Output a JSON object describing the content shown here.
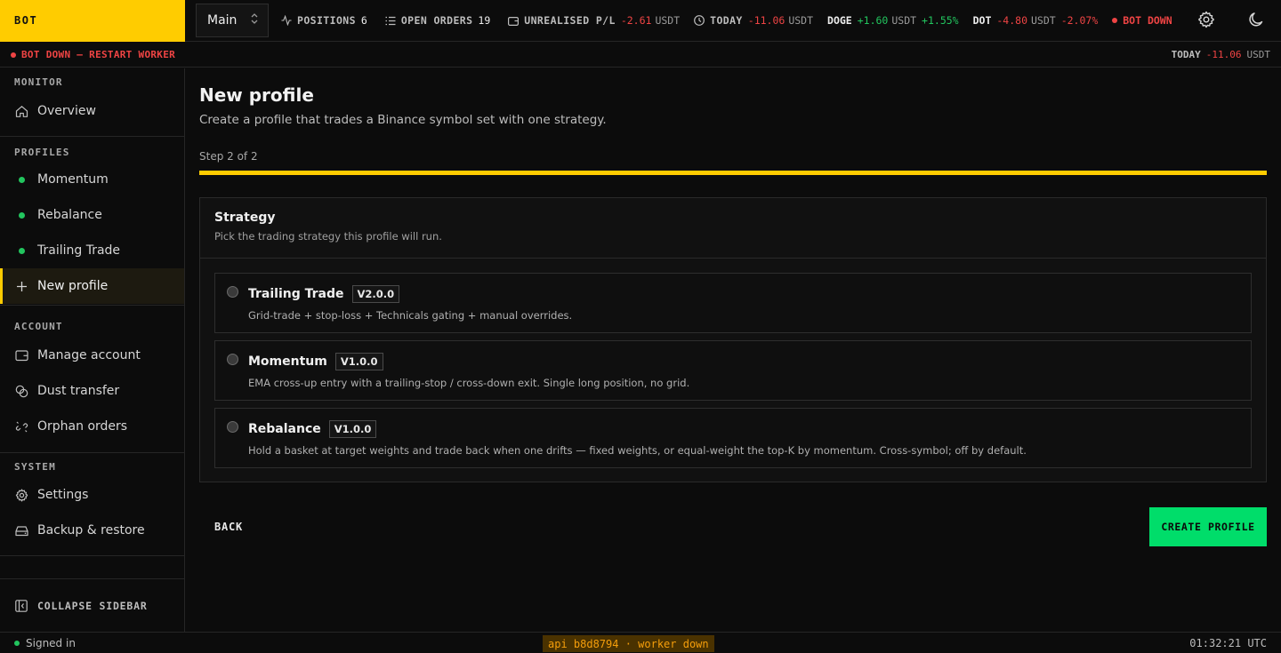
{
  "brand": "BOT",
  "account_selector": {
    "label": "Main"
  },
  "stats": {
    "positions": {
      "label": "POSITIONS",
      "value": "6"
    },
    "open_orders": {
      "label": "OPEN ORDERS",
      "value": "19"
    },
    "unrealised": {
      "label": "UNREALISED P/L",
      "value": "-2.61",
      "unit": "USDT"
    },
    "today": {
      "label": "TODAY",
      "value": "-11.06",
      "unit": "USDT"
    },
    "doge": {
      "symbol": "DOGE",
      "value": "+1.60",
      "unit": "USDT",
      "pct": "+1.55%"
    },
    "dot": {
      "symbol": "DOT",
      "value": "-4.80",
      "unit": "USDT",
      "pct": "-2.07%"
    },
    "bot_status": "BOT DOWN"
  },
  "alert": {
    "message": "BOT DOWN — RESTART WORKER",
    "today_label": "TODAY",
    "today_value": "-11.06",
    "today_unit": "USDT"
  },
  "sidebar": {
    "monitor_title": "MONITOR",
    "overview": "Overview",
    "profiles_title": "PROFILES",
    "profiles": [
      "Momentum",
      "Rebalance",
      "Trailing Trade"
    ],
    "new_profile": "New profile",
    "account_title": "ACCOUNT",
    "manage_account": "Manage account",
    "dust_transfer": "Dust transfer",
    "orphan_orders": "Orphan orders",
    "system_title": "SYSTEM",
    "settings": "Settings",
    "backup": "Backup & restore",
    "collapse": "COLLAPSE SIDEBAR"
  },
  "main": {
    "title": "New profile",
    "subtitle": "Create a profile that trades a Binance symbol set with one strategy.",
    "step": "Step 2 of 2",
    "progress": 1.0,
    "card": {
      "title": "Strategy",
      "desc": "Pick the trading strategy this profile will run.",
      "options": [
        {
          "name": "Trailing Trade",
          "version": "V2.0.0",
          "desc": "Grid-trade + stop-loss + Technicals gating + manual overrides."
        },
        {
          "name": "Momentum",
          "version": "V1.0.0",
          "desc": "EMA cross-up entry with a trailing-stop / cross-down exit. Single long position, no grid."
        },
        {
          "name": "Rebalance",
          "version": "V1.0.0",
          "desc": "Hold a basket at target weights and trade back when one drifts — fixed weights, or equal-weight the top-K by momentum. Cross-symbol; off by default."
        }
      ]
    },
    "back": "BACK",
    "create": "CREATE PROFILE"
  },
  "footer": {
    "signed_in": "Signed in",
    "api_status": "api b8d8794 · worker down",
    "clock": "01:32:21 UTC"
  },
  "colors": {
    "accent": "#ffcc00",
    "success": "#00dd6a",
    "danger": "#ef4444",
    "positive": "#22c55e"
  }
}
